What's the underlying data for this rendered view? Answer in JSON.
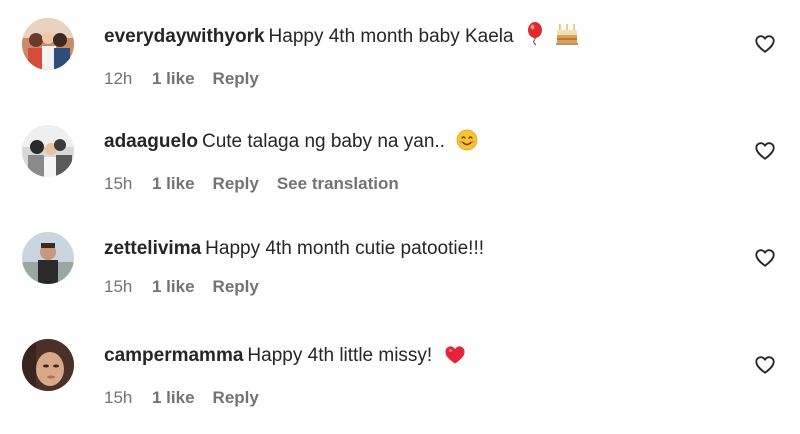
{
  "comments": [
    {
      "username": "everydaywithyork",
      "text": "Happy 4th month baby Kaela",
      "emojis": [
        "balloon-emoji",
        "birthday-cake-emoji"
      ],
      "time": "12h",
      "likes": "1 like",
      "reply": "Reply"
    },
    {
      "username": "adaaguelo",
      "text": "Cute talaga ng baby na yan..",
      "emojis": [
        "smiling-face-emoji"
      ],
      "time": "15h",
      "likes": "1 like",
      "reply": "Reply",
      "translation": "See translation"
    },
    {
      "username": "zettelivima",
      "text": "Happy 4th month cutie patootie!!!",
      "time": "15h",
      "likes": "1 like",
      "reply": "Reply"
    },
    {
      "username": "campermamma",
      "text": "Happy 4th little missy!",
      "emojis": [
        "red-heart-emoji"
      ],
      "time": "15h",
      "likes": "1 like",
      "reply": "Reply"
    }
  ],
  "icons": {
    "like": "heart-outline-icon"
  },
  "colors": {
    "text": "#262626",
    "secondary": "#737373"
  }
}
